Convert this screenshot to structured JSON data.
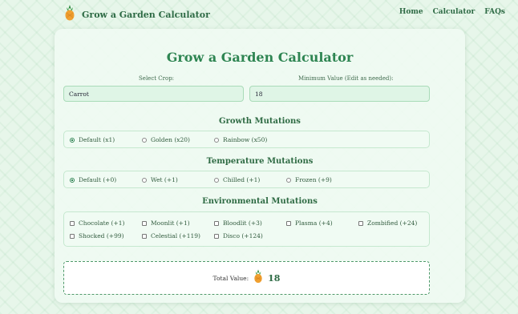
{
  "header": {
    "brand": "Grow a Garden Calculator",
    "nav": [
      "Home",
      "Calculator",
      "FAQs"
    ]
  },
  "main": {
    "title": "Grow a Garden Calculator",
    "crop_label": "Select Crop:",
    "crop_value": "Carrot",
    "min_label": "Minimum Value (Edit as needed):",
    "min_value": "18"
  },
  "growth": {
    "title": "Growth Mutations",
    "options": [
      "Default (x1)",
      "Golden (x20)",
      "Rainbow (x50)"
    ],
    "selected": "Default (x1)"
  },
  "temperature": {
    "title": "Temperature Mutations",
    "options": [
      "Default (+0)",
      "Wet (+1)",
      "Chilled (+1)",
      "Frozen (+9)"
    ],
    "selected": "Default (+0)"
  },
  "environmental": {
    "title": "Environmental Mutations",
    "options": [
      "Chocolate (+1)",
      "Moonlit (+1)",
      "Bloodlit (+3)",
      "Plasma (+4)",
      "Zombified (+24)",
      "Shocked (+99)",
      "Celestial (+119)",
      "Disco (+124)"
    ]
  },
  "total": {
    "label": "Total Value:",
    "icon": "pineapple-icon",
    "value": "18"
  },
  "colors": {
    "accent": "#2e8552",
    "background": "#e7f6ea"
  }
}
